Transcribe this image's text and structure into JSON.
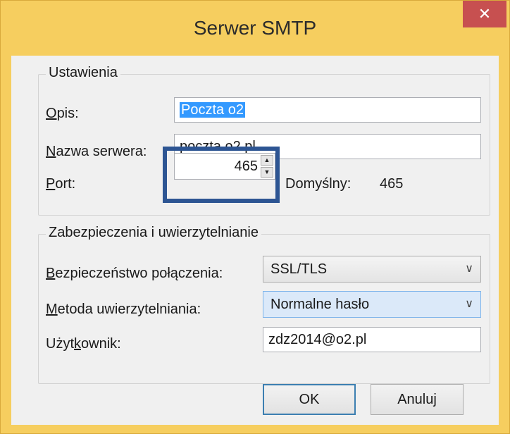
{
  "window": {
    "title": "Serwer SMTP",
    "close_glyph": "✕"
  },
  "settings_group": {
    "title": "Ustawienia",
    "description": {
      "label_underlined": "O",
      "label_rest": "pis:",
      "value": "Poczta o2"
    },
    "server_name": {
      "label_underlined": "N",
      "label_rest": "azwa serwera:",
      "value": "poczta.o2.pl"
    },
    "port": {
      "label_underlined": "P",
      "label_rest": "ort:",
      "value": "465",
      "default_label": "Domyślny:",
      "default_value": "465"
    }
  },
  "security_group": {
    "title": "Zabezpieczenia i uwierzytelnianie",
    "connection_security": {
      "label_underlined": "B",
      "label_rest": "ezpieczeństwo połączenia:",
      "selected": "SSL/TLS"
    },
    "auth_method": {
      "label_underlined": "M",
      "label_rest": "etoda uwierzytelniania:",
      "selected": "Normalne hasło"
    },
    "username": {
      "label_pre": "Użyt",
      "label_underlined": "k",
      "label_rest": "ownik:",
      "value": "zdz2014@o2.pl"
    }
  },
  "buttons": {
    "ok": "OK",
    "cancel": "Anuluj"
  },
  "icons": {
    "spin_up": "▲",
    "spin_down": "▼",
    "chevron": "∨"
  },
  "colors": {
    "frame": "#f6ce5f",
    "close_button": "#c75050",
    "highlight_rect": "#2d5593",
    "selection": "#3399ff"
  }
}
